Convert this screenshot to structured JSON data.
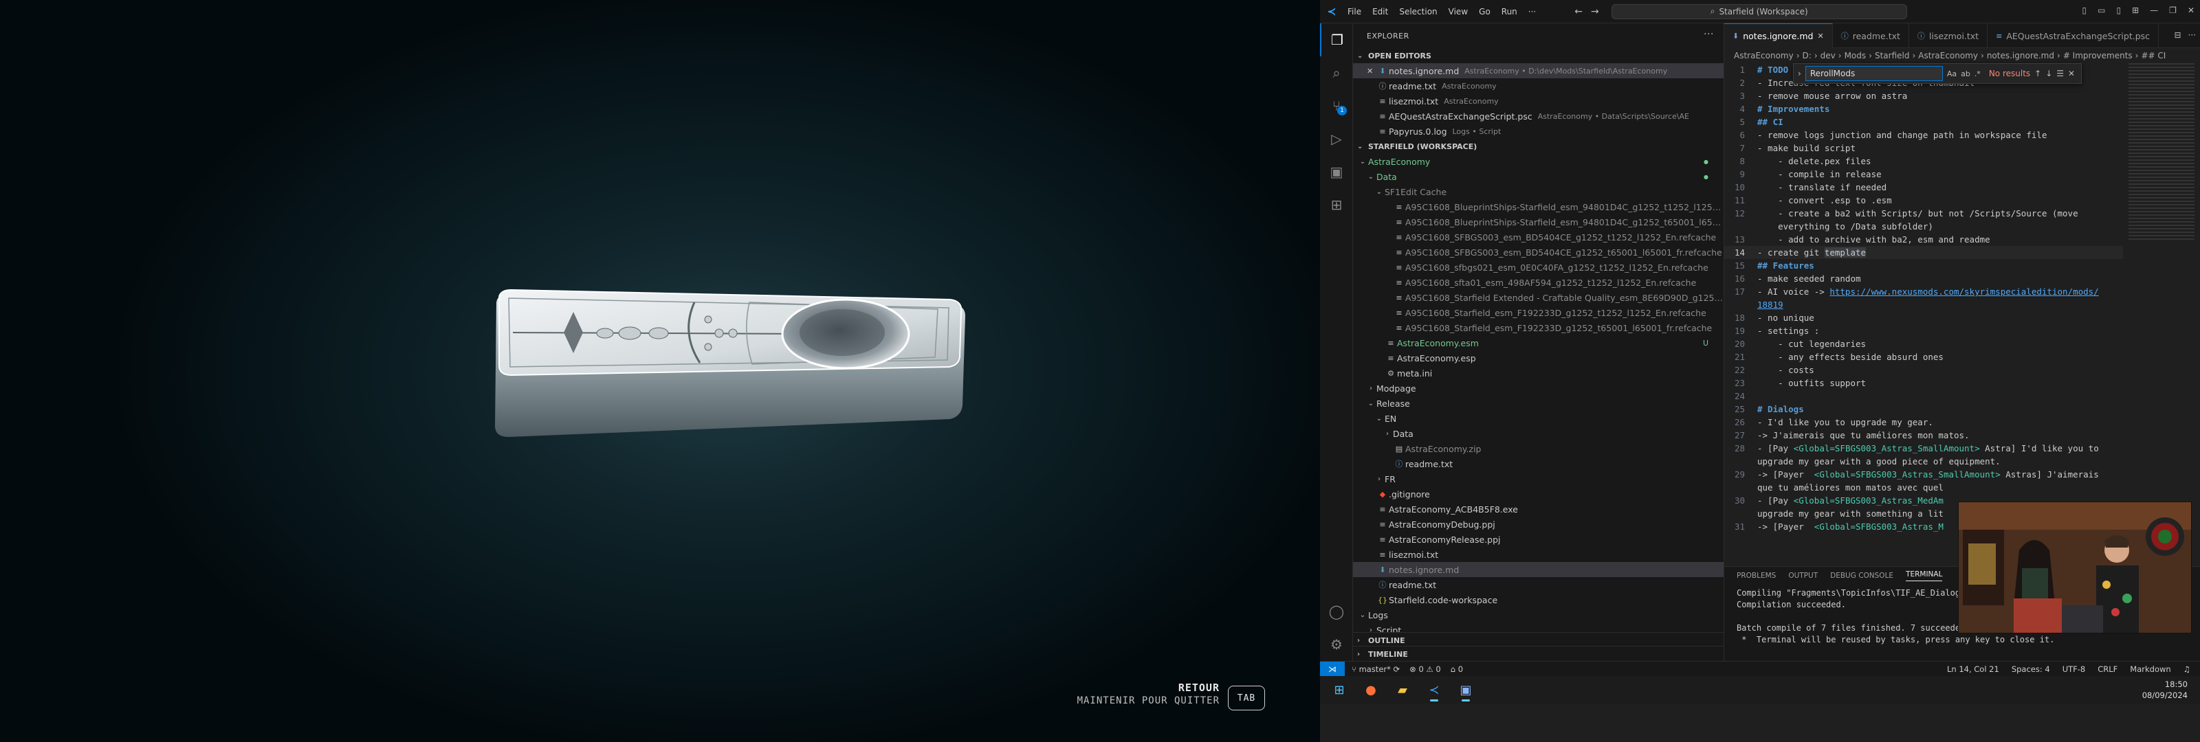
{
  "game": {
    "return_label": "RETOUR",
    "hold_quit_label": "MAINTENIR POUR QUITTER",
    "key_label": "TAB"
  },
  "vscode": {
    "menu": [
      "File",
      "Edit",
      "Selection",
      "View",
      "Go",
      "Run",
      "···"
    ],
    "command_center": "Starfield (Workspace)",
    "explorer_title": "EXPLORER",
    "open_editors_title": "OPEN EDITORS",
    "open_editors": [
      {
        "name": "notes.ignore.md",
        "desc": "AstraEconomy • D:\\dev\\Mods\\Starfield\\AstraEconomy"
      },
      {
        "name": "readme.txt",
        "desc": "AstraEconomy"
      },
      {
        "name": "lisezmoi.txt",
        "desc": "AstraEconomy"
      },
      {
        "name": "AEQuestAstraExchangeScript.psc",
        "desc": "AstraEconomy • Data\\Scripts\\Source\\AE"
      },
      {
        "name": "Papyrus.0.log",
        "desc": "Logs • Script"
      }
    ],
    "workspace_title": "STARFIELD (WORKSPACE)",
    "tree": {
      "root": "AstraEconomy",
      "data": "Data",
      "sf1edit_cache": "SF1Edit Cache",
      "cache_files": [
        "A95C1608_BlueprintShips-Starfield_esm_94801D4C_g1252_t1252_l1252_En.refcache",
        "A95C1608_BlueprintShips-Starfield_esm_94801D4C_g1252_t65001_l65001_fr.refcache",
        "A95C1608_SFBGS003_esm_BD5404CE_g1252_t1252_l1252_En.refcache",
        "A95C1608_SFBGS003_esm_BD5404CE_g1252_t65001_l65001_fr.refcache",
        "A95C1608_sfbgs021_esm_0E0C40FA_g1252_t1252_l1252_En.refcache",
        "A95C1608_sfta01_esm_498AF594_g1252_t1252_l1252_En.refcache",
        "A95C1608_Starfield Extended - Craftable Quality_esm_8E69D90D_g1252_t1252_l1...",
        "A95C1608_Starfield_esm_F192233D_g1252_t1252_l1252_En.refcache",
        "A95C1608_Starfield_esm_F192233D_g1252_t65001_l65001_fr.refcache"
      ],
      "esm": "AstraEconomy.esm",
      "esm_flag": "U",
      "esp": "AstraEconomy.esp",
      "meta": "meta.ini",
      "modpage": "Modpage",
      "release": "Release",
      "en": "EN",
      "en_data": "Data",
      "zip": "AstraEconomy.zip",
      "en_readme": "readme.txt",
      "fr": "FR",
      "gitignore": ".gitignore",
      "exe": "AstraEconomy_ACB4B5F8.exe",
      "debug_ppj": "AstraEconomyDebug.ppj",
      "release_ppj": "AstraEconomyRelease.ppj",
      "lisezmoi": "lisezmoi.txt",
      "notes": "notes.ignore.md",
      "readme": "readme.txt",
      "workspace_file": "Starfield.code-workspace",
      "logs": "Logs",
      "script": "Script"
    },
    "outline_title": "OUTLINE",
    "timeline_title": "TIMELINE",
    "tabs": [
      {
        "label": "notes.ignore.md",
        "active": true
      },
      {
        "label": "readme.txt",
        "active": false
      },
      {
        "label": "lisezmoi.txt",
        "active": false
      },
      {
        "label": "AEQuestAstraExchangeScript.psc",
        "active": false
      }
    ],
    "breadcrumbs": [
      "AstraEconomy",
      "D:",
      "dev",
      "Mods",
      "Starfield",
      "AstraEconomy",
      "notes.ignore.md",
      "# Improvements",
      "## CI"
    ],
    "find": {
      "value": "RerollMods",
      "options": [
        "Aa",
        "ab",
        ".*"
      ],
      "result": "No results"
    },
    "code": [
      {
        "n": "1",
        "t": "# TODO",
        "h": true
      },
      {
        "n": "2",
        "t": "- Increase red text font size on thumbnail"
      },
      {
        "n": "3",
        "t": "- remove mouse arrow on astra"
      },
      {
        "n": "4",
        "t": "# Improvements",
        "h": true
      },
      {
        "n": "5",
        "t": "## CI",
        "h": true
      },
      {
        "n": "6",
        "t": "- remove logs junction and change path in workspace file"
      },
      {
        "n": "7",
        "t": "- make build script"
      },
      {
        "n": "8",
        "t": "    - delete.pex files"
      },
      {
        "n": "9",
        "t": "    - compile in release"
      },
      {
        "n": "10",
        "t": "    - translate if needed"
      },
      {
        "n": "11",
        "t": "    - convert .esp to .esm"
      },
      {
        "n": "12",
        "t": "    - create a ba2 with Scripts/ but not /Scripts/Source (move"
      },
      {
        "n": "",
        "t": "    everything to /Data subfolder)"
      },
      {
        "n": "13",
        "t": "    - add to archive with ba2, esm and readme"
      },
      {
        "n": "14",
        "t": "- create git ",
        "hl": "template",
        "cur": true
      },
      {
        "n": "15",
        "t": "## Features",
        "h": true
      },
      {
        "n": "16",
        "t": "- make seeded random"
      },
      {
        "n": "17",
        "t": "- AI voice -> ",
        "link": "https://www.nexusmods.com/skyrimspecialedition/mods/"
      },
      {
        "n": "",
        "t": "",
        "link": "18819"
      },
      {
        "n": "18",
        "t": "- no unique"
      },
      {
        "n": "19",
        "t": "- settings :"
      },
      {
        "n": "20",
        "t": "    - cut legendaries"
      },
      {
        "n": "21",
        "t": "    - any effects beside absurd ones"
      },
      {
        "n": "22",
        "t": "    - costs"
      },
      {
        "n": "23",
        "t": "    - outfits support"
      },
      {
        "n": "24",
        "t": ""
      },
      {
        "n": "25",
        "t": "# Dialogs",
        "h": true
      },
      {
        "n": "26",
        "t": "- I'd like you to upgrade my gear."
      },
      {
        "n": "27",
        "t": "-> J'aimerais que tu améliores mon matos."
      },
      {
        "n": "28",
        "t": "- [Pay ",
        "tag": "<Global=SFBGS003_Astras_SmallAmount>",
        "rest": " Astra] I'd like you to"
      },
      {
        "n": "",
        "t": "upgrade my gear with a good piece of equipment."
      },
      {
        "n": "29",
        "t": "-> [Payer  ",
        "tag": "<Global=SFBGS003_Astras_SmallAmount>",
        "rest": " Astras] J'aimerais"
      },
      {
        "n": "",
        "t": "que tu améliores mon matos avec quel"
      },
      {
        "n": "30",
        "t": "- [Pay ",
        "tag": "<Global=SFBGS003_Astras_MedAm",
        "rest": ""
      },
      {
        "n": "",
        "t": "upgrade my gear with something a lit"
      },
      {
        "n": "31",
        "t": "-> [Payer  ",
        "tag": "<Global=SFBGS003_Astras_M",
        "rest": ""
      }
    ],
    "panel_tabs": [
      "PROBLEMS",
      "OUTPUT",
      "DEBUG CONSOLE",
      "TERMINAL"
    ],
    "terminal_lines": [
      "Compiling \"Fragments\\TopicInfos\\TIF_AE_Dialogu",
      "Compilation succeeded.",
      "",
      "Batch compile of 7 files finished. 7 succeeded",
      " *  Terminal will be reused by tasks, press any key to close it."
    ],
    "status": {
      "branch": "master*",
      "errors": "0",
      "warnings": "0",
      "info": "0",
      "position": "Ln 14, Col 21",
      "spaces": "Spaces: 4",
      "encoding": "UTF-8",
      "eol": "CRLF",
      "language": "Markdown"
    },
    "clock": {
      "time": "18:50",
      "date": "08/09/2024"
    }
  }
}
